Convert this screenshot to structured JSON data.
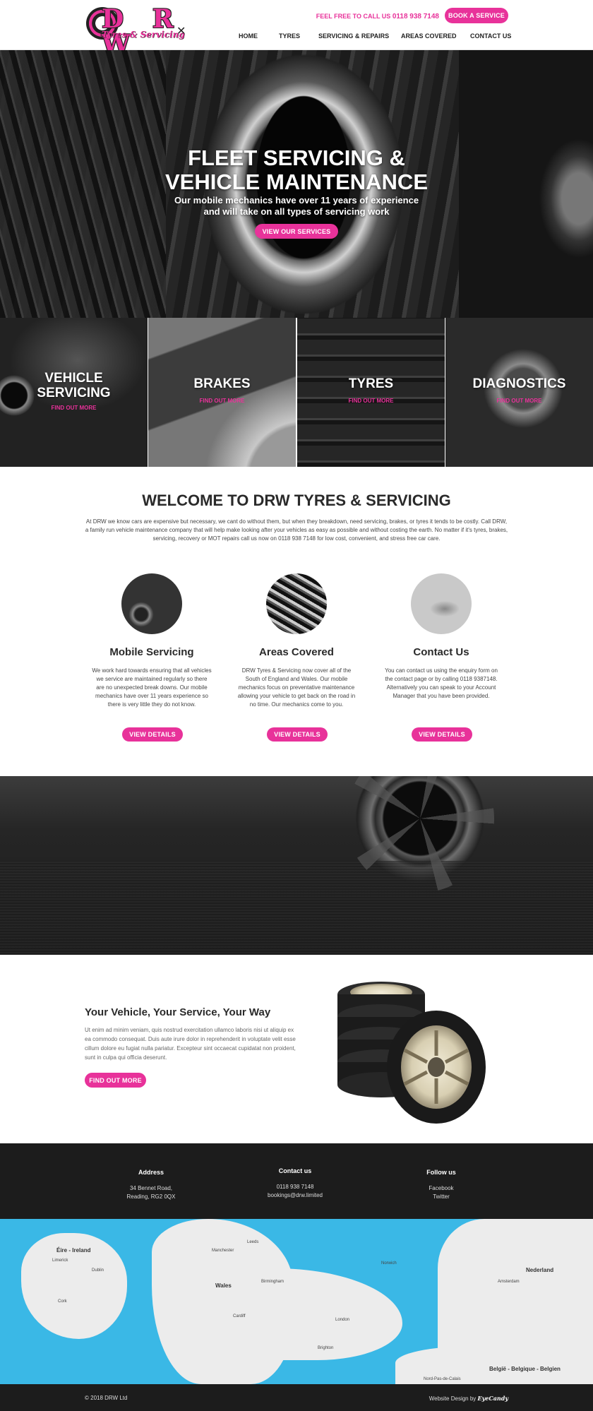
{
  "header": {
    "logo_letters": "D R W",
    "logo_script": "Tyres & Servicing",
    "call_label": "FEEL FREE TO CALL US",
    "call_number": "0118 938 7148",
    "book_label": "BOOK A SERVICE",
    "nav": [
      "HOME",
      "TYRES",
      "SERVICING & REPAIRS",
      "AREAS COVERED",
      "CONTACT US"
    ]
  },
  "hero": {
    "title_line1": "FLEET SERVICING &",
    "title_line2": "VEHICLE MAINTENANCE",
    "subtitle_line1": "Our mobile mechanics have over 11 years of experience",
    "subtitle_line2": "and will take on all types of servicing work",
    "button_label": "VIEW OUR SERVICES"
  },
  "services": [
    {
      "title_line1": "VEHICLE",
      "title_line2": "SERVICING",
      "link": "FIND OUT MORE"
    },
    {
      "title_line1": "BRAKES",
      "title_line2": "",
      "link": "FIND OUT MORE"
    },
    {
      "title_line1": "TYRES",
      "title_line2": "",
      "link": "FIND OUT MORE"
    },
    {
      "title_line1": "DIAGNOSTICS",
      "title_line2": "",
      "link": "FIND OUT MORE"
    }
  ],
  "welcome": {
    "title": "WELCOME TO DRW TYRES & SERVICING",
    "text": "At DRW we know cars are expensive but necessary, we cant do without them, but when they breakdown, need servicing, brakes, or tyres it tends to be costly. Call DRW, a family run vehicle maintenance company that will help make looking after your vehicles as easy as possible and without costing the earth. No matter if it's tyres, brakes, servicing, recovery or MOT repairs call us now on 0118 938 7148 for low cost, convenient, and stress free car care."
  },
  "features": [
    {
      "title": "Mobile Servicing",
      "text": "We work hard towards ensuring that all vehicles we service are maintained regularly so there are no unexpected break downs. Our mobile mechanics have over 11 years experience so there is very little they do not know.",
      "button": "VIEW DETAILS"
    },
    {
      "title": "Areas Covered",
      "text": "DRW Tyres & Servicing now cover all of the South of England and Wales. Our mobile mechanics focus on preventative maintenance allowing your vehicle to get back on the road in no time. Our mechanics come to you.",
      "button": "VIEW DETAILS"
    },
    {
      "title": "Contact Us",
      "text": "You can contact us using the enquiry form on the contact page or by calling 0118 9387148. Alternatively you can speak to your Account Manager that you have been provided.",
      "button": "VIEW DETAILS"
    }
  ],
  "vehicle": {
    "title": "Your Vehicle, Your Service, Your Way",
    "text": "Ut enim ad minim veniam, quis nostrud exercitation ullamco laboris nisi ut aliquip ex ea commodo consequat. Duis aute irure dolor in reprehenderit in voluptate velit esse cillum dolore eu fugiat nulla pariatur. Excepteur sint occaecat cupidatat non proident, sunt in culpa qui officia deserunt.",
    "button": "FIND OUT MORE"
  },
  "footer": {
    "address_heading": "Address",
    "address_line1": "34 Bennet Road,",
    "address_line2": "Reading, RG2 0QX",
    "contact_heading": "Contact us",
    "contact_phone": "0118 938 7148",
    "contact_email": "bookings@drw.limited",
    "follow_heading": "Follow us",
    "follow_facebook": "Facebook",
    "follow_twitter": "Twitter"
  },
  "map_labels": {
    "ireland": "Éire - Ireland",
    "nederland": "Nederland",
    "belgie": "België - Belgique - Belgien",
    "nord": "Nord-Pas-de-Calais",
    "london": "London",
    "wales": "Wales",
    "birmingham": "Birmingham",
    "manchester": "Manchester",
    "cardiff": "Cardiff",
    "norwich": "Norwich",
    "brighton": "Brighton",
    "amsterdam": "Amsterdam",
    "cork": "Cork",
    "limerick": "Limerick",
    "dublin": "Dublin",
    "leeds": "Leeds"
  },
  "bottom": {
    "copyright": "© 2018 DRW Ltd",
    "credit_prefix": "Website Design by",
    "credit_brand": "EyeCandy"
  }
}
